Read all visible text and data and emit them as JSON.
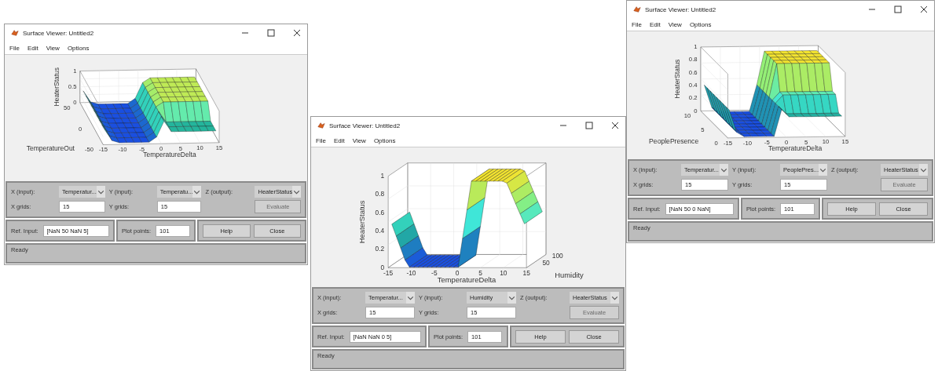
{
  "windows": [
    {
      "title": "Surface Viewer: Untitled2",
      "menu": [
        "File",
        "Edit",
        "View",
        "Options"
      ],
      "plot": {
        "zlabel": "HeaterStatus",
        "xlabel": "TemperatureDelta",
        "ylabel": "TemperatureOut",
        "zticks": [
          "1",
          "0.5",
          "0"
        ],
        "xticks": [
          "-15",
          "-10",
          "-5",
          "0",
          "5",
          "10",
          "15"
        ],
        "yticks": [
          "-50",
          "0",
          "50"
        ]
      },
      "controls": {
        "x_input_label": "X (input):",
        "x_input": "Temperatur...",
        "y_input_label": "Y (input):",
        "y_input": "Temperatu...",
        "z_output_label": "Z (output):",
        "z_output": "HeaterStatus",
        "x_grids_label": "X grids:",
        "x_grids": "15",
        "y_grids_label": "Y grids:",
        "y_grids": "15",
        "evaluate": {
          "label": "Evaluate",
          "disabled": true
        }
      },
      "ref_input_label": "Ref. Input:",
      "ref_input": "[NaN 50 NaN 5]",
      "plot_points_label": "Plot points:",
      "plot_points": "101",
      "buttons": [
        "Help",
        "Close"
      ],
      "status": "Ready"
    },
    {
      "title": "Surface Viewer: Untitled2",
      "menu": [
        "File",
        "Edit",
        "View",
        "Options"
      ],
      "plot": {
        "zlabel": "HeaterStatus",
        "xlabel": "TemperatureDelta",
        "ylabel": "Humidity",
        "zticks": [
          "1",
          "0.8",
          "0.6",
          "0.4",
          "0.2",
          "0"
        ],
        "xticks": [
          "-15",
          "-10",
          "-5",
          "0",
          "5",
          "10",
          "15"
        ],
        "yticks": [
          "50",
          "100"
        ]
      },
      "controls": {
        "x_input_label": "X (input):",
        "x_input": "Temperatur...",
        "y_input_label": "Y (input):",
        "y_input": "Humidity",
        "z_output_label": "Z (output):",
        "z_output": "HeaterStatus",
        "x_grids_label": "X grids:",
        "x_grids": "15",
        "y_grids_label": "Y grids:",
        "y_grids": "15",
        "evaluate": {
          "label": "Evaluate",
          "disabled": true
        }
      },
      "ref_input_label": "Ref. Input:",
      "ref_input": "[NaN NaN 0 5]",
      "plot_points_label": "Plot points:",
      "plot_points": "101",
      "buttons": [
        "Help",
        "Close"
      ],
      "status": "Ready"
    },
    {
      "title": "Surface Viewer: Untitled2",
      "menu": [
        "File",
        "Edit",
        "View",
        "Options"
      ],
      "plot": {
        "zlabel": "HeaterStatus",
        "xlabel": "TemperatureDelta",
        "ylabel": "PeoplePresence",
        "zticks": [
          "1",
          "0.8",
          "0.6",
          "0.4",
          "0.2",
          "0"
        ],
        "xticks": [
          "-15",
          "-10",
          "-5",
          "0",
          "5",
          "10",
          "15"
        ],
        "yticks": [
          "0",
          "5",
          "10"
        ]
      },
      "controls": {
        "x_input_label": "X (input):",
        "x_input": "Temperatur...",
        "y_input_label": "Y (input):",
        "y_input": "PeoplePres...",
        "z_output_label": "Z (output):",
        "z_output": "HeaterStatus",
        "x_grids_label": "X grids:",
        "x_grids": "15",
        "y_grids_label": "Y grids:",
        "y_grids": "15",
        "evaluate": {
          "label": "Evaluate",
          "disabled": true
        }
      },
      "ref_input_label": "Ref. Input:",
      "ref_input": "[NaN 50 0 NaN]",
      "plot_points_label": "Plot points:",
      "plot_points": "101",
      "buttons": [
        "Help",
        "Close"
      ],
      "status": "Ready"
    }
  ]
}
